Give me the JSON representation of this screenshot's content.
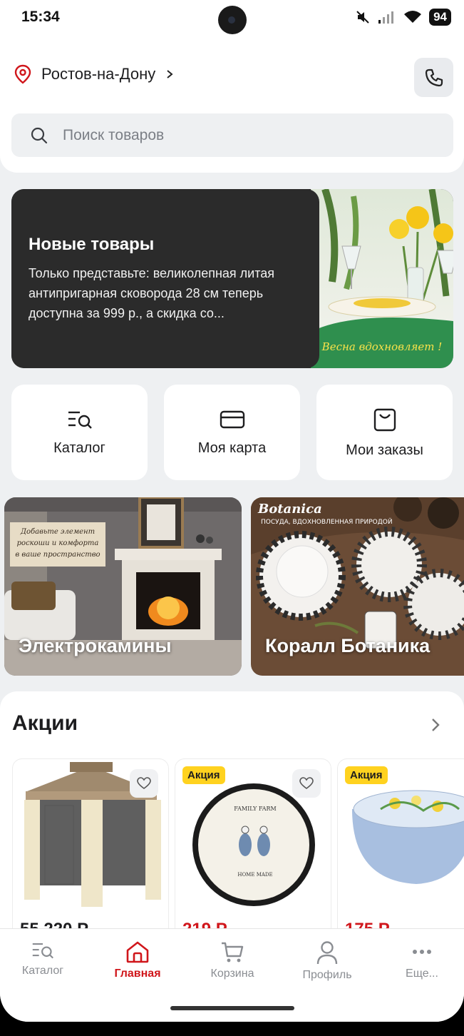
{
  "status_bar": {
    "time": "15:34",
    "battery": "94"
  },
  "header": {
    "city": "Ростов-на-Дону",
    "search_placeholder": "Поиск товаров"
  },
  "banner": {
    "title": "Новые товары",
    "description": "Только представьте: великолепная литая антипригарная сковорода 28 см теперь доступна за 999 р., а скидка со...",
    "image_caption": "Весна вдохновляет !"
  },
  "tiles": [
    {
      "label": "Каталог",
      "icon": "catalog-icon"
    },
    {
      "label": "Моя карта",
      "icon": "card-icon"
    },
    {
      "label": "Мои заказы",
      "icon": "bag-icon"
    }
  ],
  "categories": [
    {
      "label": "Электрокамины",
      "image_text": "Добавьте элемент роскоши и комфорта в ваше пространство"
    },
    {
      "label": "Коралл Ботаника",
      "image_brand": "Botanica",
      "image_tagline": "ПОСУДА, ВДОХНОВЛЕННАЯ ПРИРОДОЙ"
    }
  ],
  "promotions": {
    "title": "Акции",
    "products": [
      {
        "badge": "",
        "price": "55 220 Р",
        "image": "gazebo"
      },
      {
        "badge": "Акция",
        "price": "219 Р",
        "image": "plate"
      },
      {
        "badge": "Акция",
        "price": "175 Р",
        "image": "bowl"
      }
    ],
    "plate_text": [
      "FAMILY FARM",
      "HOME MADE"
    ]
  },
  "bottom_nav": [
    {
      "label": "Каталог",
      "icon": "catalog-icon",
      "active": false
    },
    {
      "label": "Главная",
      "icon": "home-icon",
      "active": true
    },
    {
      "label": "Корзина",
      "icon": "cart-icon",
      "active": false
    },
    {
      "label": "Профиль",
      "icon": "profile-icon",
      "active": false
    },
    {
      "label": "Еще...",
      "icon": "more-icon",
      "active": false
    }
  ],
  "colors": {
    "accent": "#d0161b",
    "badge": "#ffd21f",
    "banner_bg": "#2b2b2b",
    "page_bg": "#eef0f2"
  }
}
